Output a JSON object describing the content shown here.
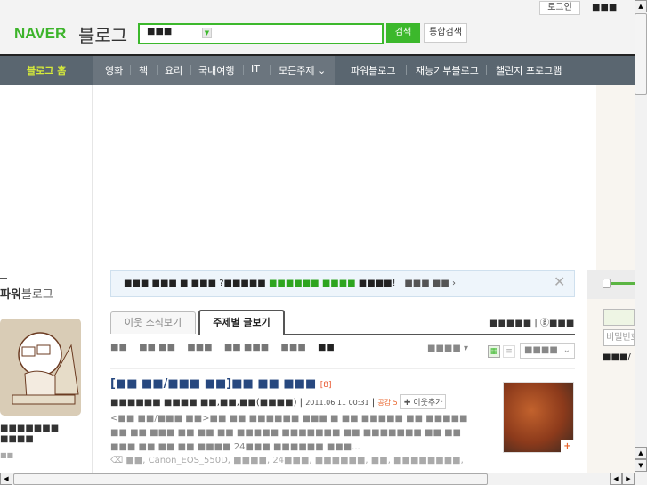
{
  "header": {
    "login": "로그인",
    "top_misc": "■■■",
    "logo_naver": "NAVER",
    "logo_blog": "블로그",
    "search_scope": "■■■",
    "search_value": "",
    "search_button": "검색",
    "total_search_button": "통합검색"
  },
  "nav": {
    "home": "블로그 홈",
    "items": [
      "영화",
      "책",
      "요리",
      "국내여행",
      "IT",
      "모든주제 ⌄"
    ],
    "right_items": [
      "파워블로그",
      "재능기부블로그",
      "챌린지 프로그램"
    ]
  },
  "notice": {
    "text1": "■■■ ■■■ ■ ■■■ ?■■■■■ ",
    "text_green1": "■■■■■■",
    "text_green2": "■■■■",
    "text2": " ■■■■!",
    "link": "■■■ ■■ ›"
  },
  "tabs": {
    "tab1": "이웃 소식보기",
    "tab2": "주제별 글보기",
    "right_text": "■■■■■ | ⓖ■■■"
  },
  "filters": [
    "■■",
    "■■ ■■",
    "■■■",
    "■■ ■■■",
    "■■■",
    "■■"
  ],
  "sort": {
    "label": "■■■■ ▾",
    "select": "■■■■"
  },
  "post": {
    "title": "[■■ ■■/■■■ ■■]■■ ■■ ■■■",
    "count": "[8]",
    "author": "■■■■■■ ■■■■ ■■,■■,■■(■■■■)",
    "date": "2011.06.11 00:31",
    "like": "공감 5",
    "add_neighbor": "✚ 이웃추가",
    "body": "<■■ ■■/■■■ ■■>■■ ■■ ■■■■■■ ■■■ ■ ■■ ■■■■■ ■■ ■■■■■ ■■ ■■ ■■■ ■■ ■■ ■■ ■■■■■ ■■■■■■■ ■■ ■■■■■■■ ■■ ■■ ■■■ ■■ ■■ ■■ ■■■■ 24■■■ ■■■■■■ ■■■...",
    "tags": "■■, Canon_EOS_550D, ■■■■, 24■■■, ■■■■■■, ■■, ■■■■■■■■,"
  },
  "right": {
    "password_placeholder": "비밀번호",
    "join": "■■■/"
  },
  "left": {
    "title_bold": "파워",
    "title_rest": "블로그",
    "name": "■■■■■■■ ■■■■",
    "sub": "■■"
  }
}
